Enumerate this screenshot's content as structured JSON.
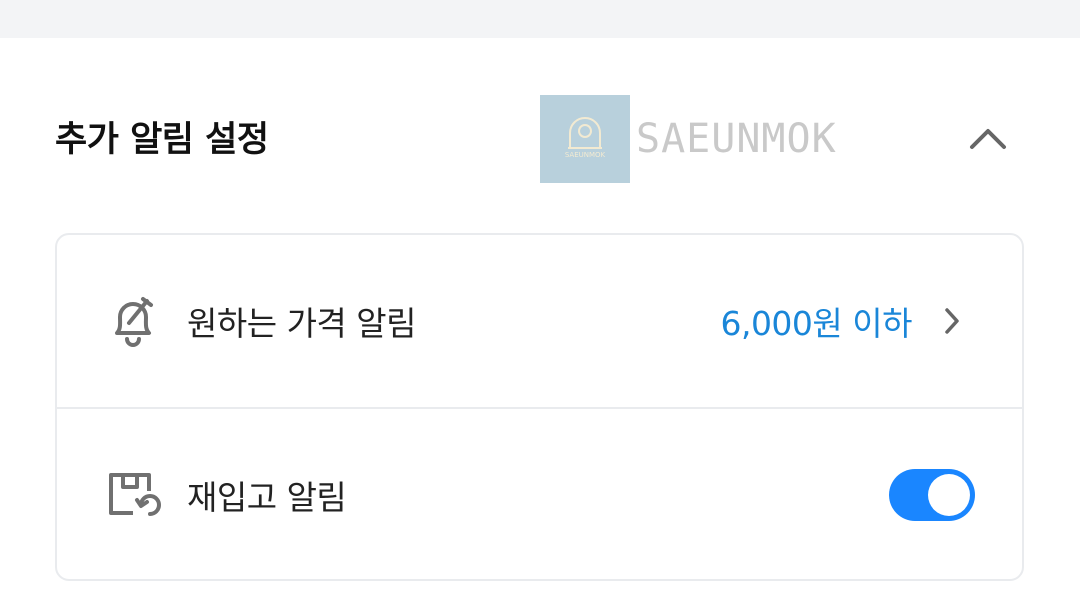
{
  "section": {
    "title": "추가 알림 설정",
    "collapse_icon": "chevron-up-icon"
  },
  "watermark": {
    "text": "SAEUNMOK",
    "logo_text": "SAEUNMOK"
  },
  "alerts": {
    "price_alert": {
      "icon": "bell-icon",
      "label": "원하는 가격 알림",
      "value": "6,000원 이하",
      "value_color": "#1a86d8",
      "chevron_icon": "chevron-right-icon"
    },
    "restock_alert": {
      "icon": "restock-box-icon",
      "label": "재입고 알림",
      "toggle_on": true,
      "toggle_color": "#1a86ff"
    }
  }
}
